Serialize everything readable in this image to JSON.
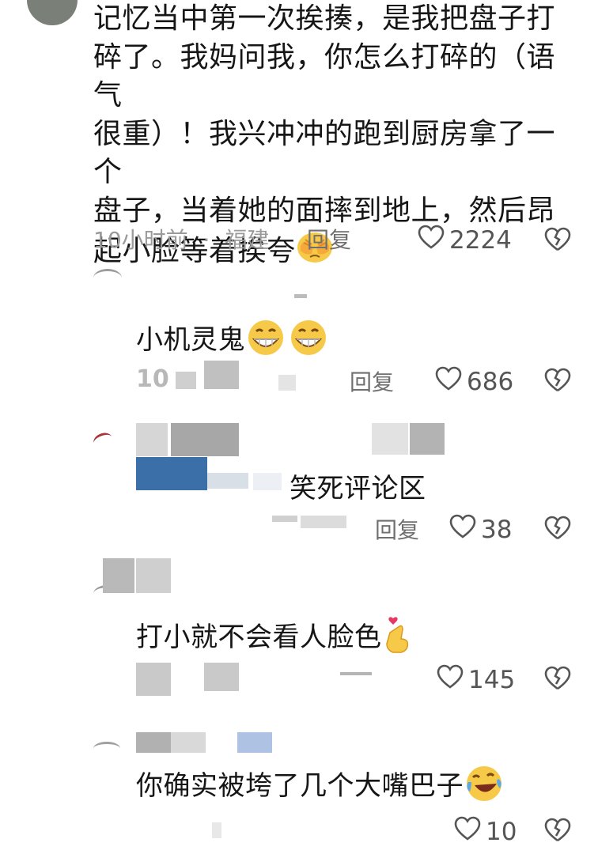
{
  "main_comment": {
    "lines": [
      "记忆当中第一次挨揍，是我把盘子打",
      "碎了。我妈问我，你怎么打碎的（语气",
      "很重）！我兴冲冲的跑到厨房拿了一个",
      "盘子，当着她的面摔到地上，然后昂",
      "起小脸等着挨夸"
    ],
    "emoji": "hands-covering-face-icon",
    "time": "10小时前",
    "dot": "·",
    "location": "福建",
    "reply": "回复",
    "likes": "2224"
  },
  "replies": [
    {
      "text": "小机灵鬼",
      "emoji": "grinning-face-icon",
      "reply": "回复",
      "likes": "686",
      "partial_meta": "10"
    },
    {
      "text": "笑死评论区",
      "reply": "回复",
      "likes": "38"
    },
    {
      "text": "打小就不会看人脸色",
      "emoji": "heart-fingers-icon",
      "likes": "145"
    },
    {
      "text": "你确实被垮了几个大嘴巴子",
      "emoji": "rolling-laughing-icon",
      "likes": "10"
    }
  ],
  "colors": {
    "text": "#161616",
    "meta": "#9a9a9a",
    "icon": "#555555",
    "blur_gray": "#a9a9a9",
    "blur_blue": "#3b6fa8"
  }
}
